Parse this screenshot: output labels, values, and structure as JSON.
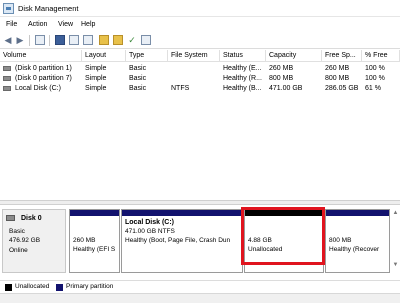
{
  "window": {
    "title": "Disk Management"
  },
  "menu": [
    "File",
    "Action",
    "View",
    "Help"
  ],
  "toolbar": {
    "icons": [
      "back-arrow-icon",
      "forward-arrow-icon",
      "console-tree-icon",
      "help-topics-icon",
      "properties-icon",
      "list-view-icon",
      "key-icon",
      "folder-icon",
      "check-icon",
      "bottom-view-icon"
    ]
  },
  "volume_list": {
    "columns": [
      "Volume",
      "Layout",
      "Type",
      "File System",
      "Status",
      "Capacity",
      "Free Sp...",
      "% Free"
    ],
    "rows": [
      [
        "(Disk 0 partition 1)",
        "Simple",
        "Basic",
        "",
        "Healthy (E...",
        "260 MB",
        "260 MB",
        "100 %"
      ],
      [
        "(Disk 0 partition 7)",
        "Simple",
        "Basic",
        "",
        "Healthy (R...",
        "800 MB",
        "800 MB",
        "100 %"
      ],
      [
        "Local Disk (C:)",
        "Simple",
        "Basic",
        "NTFS",
        "Healthy (B...",
        "471.00 GB",
        "286.05 GB",
        "61 %"
      ]
    ]
  },
  "disk": {
    "name": "Disk 0",
    "type": "Basic",
    "size": "476.92 GB",
    "status": "Online"
  },
  "partitions": [
    {
      "title": "",
      "size": "260 MB",
      "status": "Healthy (EFI S"
    },
    {
      "title": "Local Disk  (C:)",
      "size": "471.00 GB NTFS",
      "status": "Healthy (Boot, Page File, Crash Dun"
    },
    {
      "title": "",
      "size": "4.88 GB",
      "status": "Unallocated"
    },
    {
      "title": "",
      "size": "800 MB",
      "status": "Healthy (Recover"
    }
  ],
  "legend": {
    "items": [
      {
        "label": "Unallocated",
        "color": "#000000"
      },
      {
        "label": "Primary partition",
        "color": "#12126e"
      }
    ]
  },
  "colors": {
    "primary_partition": "#12126e",
    "unallocated": "#000000",
    "highlight": "#e0141e"
  }
}
